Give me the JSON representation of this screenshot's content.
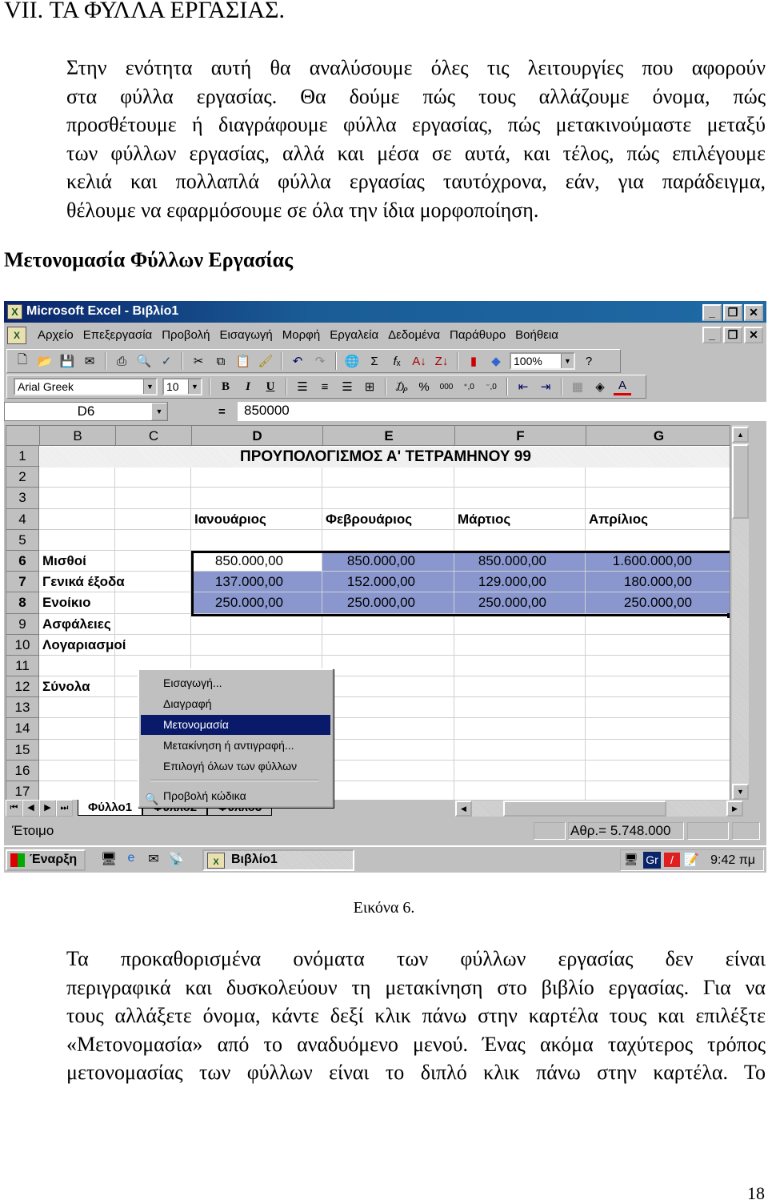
{
  "document": {
    "chapter_title": "VII.  ΤΑ ΦΥΛΛΑ ΕΡΓΑΣΙΑΣ.",
    "intro_lines": [
      "Στην ενότητα αυτή θα αναλύσουμε όλες τις λειτουργίες που αφορούν",
      "στα φύλλα εργασίας. Θα δούμε πώς τους αλλάζουμε όνομα, πώς",
      "προσθέτουμε ή διαγράφουμε φύλλα εργασίας, πώς μετακινούμαστε μεταξύ",
      "των φύλλων εργασίας, αλλά και μέσα σε αυτά, και τέλος, πώς επιλέγουμε",
      "κελιά και πολλαπλά φύλλα εργασίας ταυτόχρονα, εάν, για παράδειγμα,",
      "θέλουμε να εφαρμόσουμε σε όλα την ίδια μορφοποίηση."
    ],
    "section_heading": "Μετονομασία Φύλλων Εργασίας",
    "figure_caption": "Εικόνα 6.",
    "body_lines": [
      "Τα προκαθορισμένα ονόματα των φύλλων εργασίας δεν είναι",
      "περιγραφικά και δυσκολεύουν τη μετακίνηση στο βιβλίο εργασίας. Για να",
      "τους αλλάξετε όνομα, κάντε δεξί κλικ πάνω στην καρτέλα τους και επιλέξτε",
      "«Μετονομασία» από το αναδυόμενο μενού. Ένας ακόμα ταχύτερος τρόπος",
      "μετονομασίας των φύλλων είναι το διπλό κλικ πάνω στην καρτέλα. Το"
    ],
    "page_number": "18"
  },
  "excel": {
    "window_title": "Microsoft Excel - Βιβλίο1",
    "window_buttons": {
      "minimize": "_",
      "restore": "❐",
      "close": "✕"
    },
    "menu": [
      "Αρχείο",
      "Επεξεργασία",
      "Προβολή",
      "Εισαγωγή",
      "Μορφή",
      "Εργαλεία",
      "Δεδομένα",
      "Παράθυρο",
      "Βοήθεια"
    ],
    "standard_toolbar": {
      "icons": [
        "new-icon",
        "open-icon",
        "save-icon",
        "email-icon",
        "print-icon",
        "print-preview-icon",
        "spelling-icon",
        "cut-icon",
        "copy-icon",
        "paste-icon",
        "format-painter-icon",
        "undo-icon",
        "redo-icon",
        "hyperlink-icon",
        "autosum-icon",
        "function-icon",
        "sort-ascending-icon",
        "sort-descending-icon",
        "chart-wizard-icon",
        "drawing-icon",
        "help-icon"
      ],
      "zoom": "100%"
    },
    "formatting_toolbar": {
      "font": "Arial Greek",
      "size": "10",
      "bold": "B",
      "italic": "I",
      "underline": "U",
      "currency": "₯",
      "percent": "%",
      "comma": "000",
      "increase_decimal": "⁺,0",
      "decrease_decimal": "⁻,0"
    },
    "formula_bar": {
      "name_box": "D6",
      "equals": "=",
      "value": "850000"
    },
    "columns": [
      "B",
      "C",
      "D",
      "E",
      "F",
      "G"
    ],
    "selected_columns": [
      "D",
      "E",
      "F",
      "G"
    ],
    "rows": [
      "1",
      "2",
      "3",
      "4",
      "5",
      "6",
      "7",
      "8",
      "9",
      "10",
      "11",
      "12",
      "13",
      "14",
      "15",
      "16",
      "17"
    ],
    "selected_rows": [
      "6",
      "7",
      "8"
    ],
    "sheet_title": "ΠΡΟΥΠΟΛΟΓΙΣΜΟΣ Α' ΤΕΤΡΑΜΗΝΟΥ 99",
    "months": [
      "Ιανουάριος",
      "Φεβρουάριος",
      "Μάρτιος",
      "Απρίλιος"
    ],
    "row_labels": {
      "6": "Μισθοί",
      "7": "Γενικά έξοδα",
      "8": "Ενοίκιο",
      "9": "Ασφάλειες",
      "10": "Λογαριασμοί",
      "12": "Σύνολα"
    },
    "values": {
      "6": [
        "850.000,00",
        "850.000,00",
        "850.000,00",
        "1.600.000,00"
      ],
      "7": [
        "137.000,00",
        "152.000,00",
        "129.000,00",
        "180.000,00"
      ],
      "8": [
        "250.000,00",
        "250.000,00",
        "250.000,00",
        "250.000,00"
      ]
    },
    "sheet_tabs": [
      "Φύλλο1",
      "Φύλλο2",
      "Φύλλο3"
    ],
    "active_sheet": "Φύλλο1",
    "context_menu": [
      {
        "label": "Εισαγωγή...",
        "highlighted": false
      },
      {
        "label": "Διαγραφή",
        "highlighted": false
      },
      {
        "label": "Μετονομασία",
        "highlighted": true
      },
      {
        "label": "Μετακίνηση ή αντιγραφή...",
        "highlighted": false
      },
      {
        "label": "Επιλογή όλων των φύλλων",
        "highlighted": false
      },
      {
        "label": "Προβολή κώδικα",
        "highlighted": false,
        "icon": "view-code-icon"
      }
    ],
    "status": {
      "text": "Έτοιμο",
      "sum": "Αθρ.= 5.748.000"
    },
    "taskbar": {
      "start": "Έναρξη",
      "task": "Βιβλίο1",
      "language": "Gr",
      "clock": "9:42 πμ"
    }
  }
}
